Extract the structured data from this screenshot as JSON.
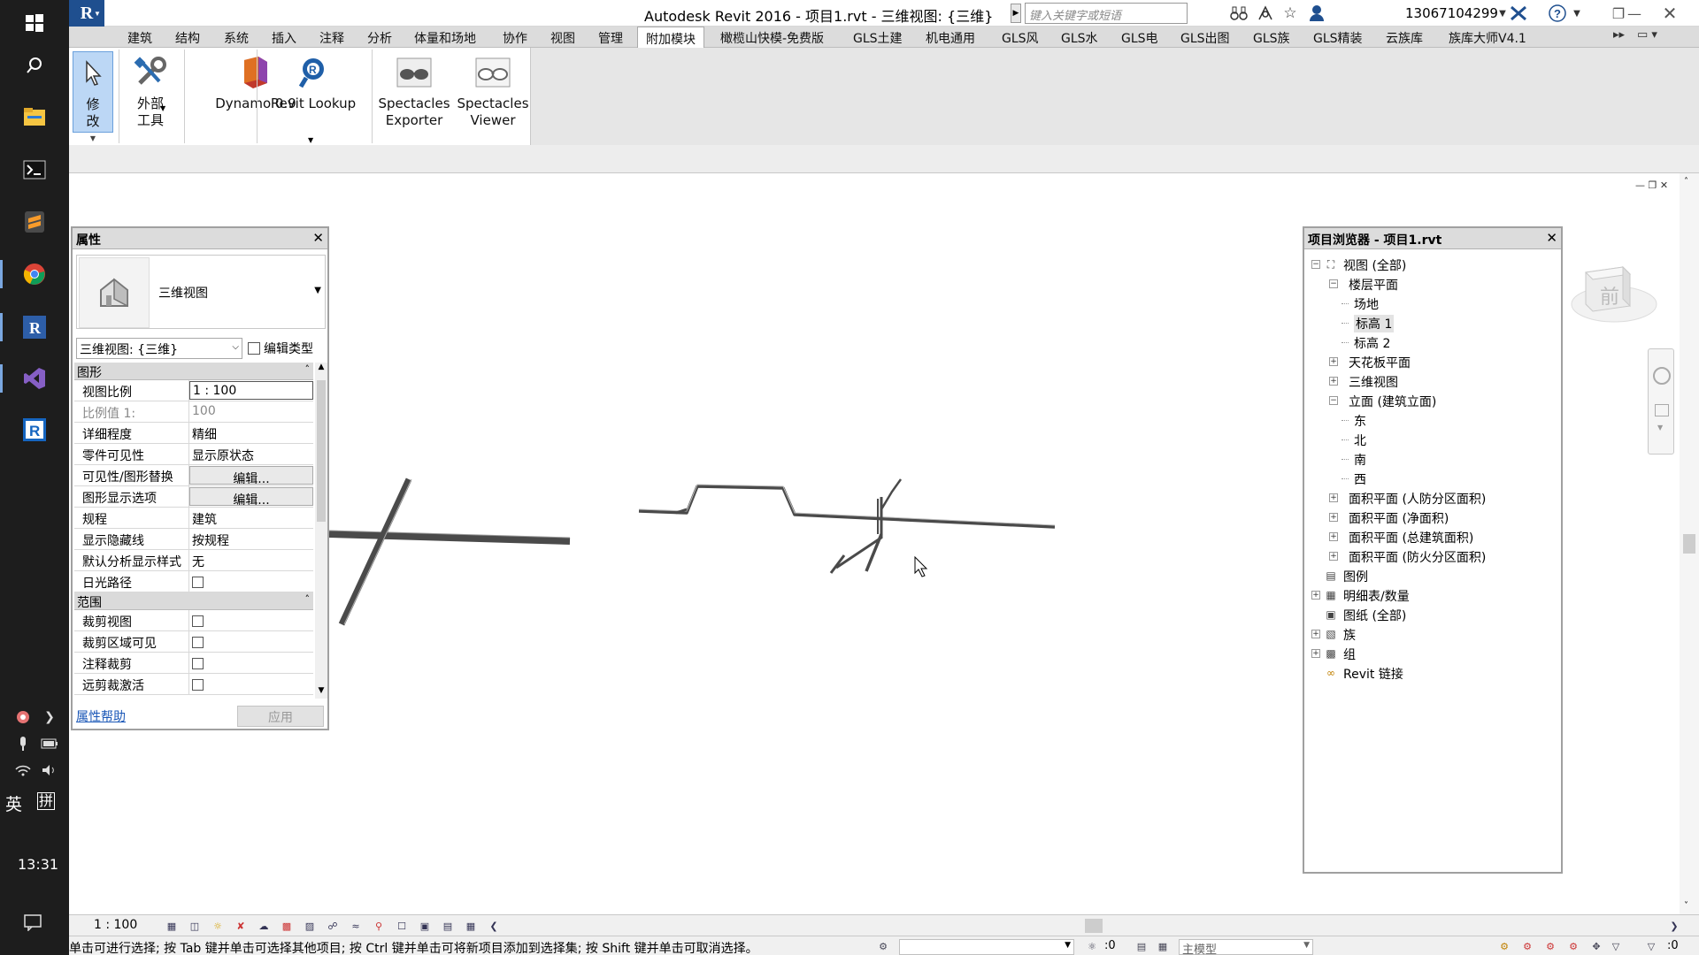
{
  "taskbar": {
    "time": "13:31",
    "ime_lang": "英",
    "ime_mode": "拼"
  },
  "window": {
    "title": "Autodesk Revit 2016 -    项目1.rvt - 三维视图: {三维}",
    "search_placeholder": "键入关键字或短语",
    "user": "13067104299"
  },
  "ribbon": {
    "tabs": [
      "建筑",
      "结构",
      "系统",
      "插入",
      "注释",
      "分析",
      "体量和场地",
      "协作",
      "视图",
      "管理",
      "附加模块",
      "橄榄山快模-免费版",
      "GLS土建",
      "机电通用",
      "GLS风",
      "GLS水",
      "GLS电",
      "GLS出图",
      "GLS族",
      "GLS精装",
      "云族库",
      "族库大师V4.1"
    ],
    "active_tab": "附加模块",
    "buttons": {
      "modify": "修改",
      "external_tools": "外部\n工具",
      "dynamo": "Dynamo 0.9",
      "revit_lookup": "Revit Lookup",
      "spectacles_exporter": "Spectacles\nExporter",
      "spectacles_viewer": "Spectacles\nViewer"
    }
  },
  "properties": {
    "title": "属性",
    "type_name": "三维视图",
    "instance_selector": "三维视图: {三维}",
    "edit_type": "编辑类型",
    "group_graphics": "图形",
    "group_extents": "范围",
    "rows_graphics": [
      {
        "name": "视图比例",
        "value": "1 : 100",
        "kind": "input"
      },
      {
        "name": "比例值 1:",
        "value": "100",
        "kind": "gray"
      },
      {
        "name": "详细程度",
        "value": "精细",
        "kind": "text"
      },
      {
        "name": "零件可见性",
        "value": "显示原状态",
        "kind": "text"
      },
      {
        "name": "可见性/图形替换",
        "value": "编辑...",
        "kind": "button"
      },
      {
        "name": "图形显示选项",
        "value": "编辑...",
        "kind": "button"
      },
      {
        "name": "规程",
        "value": "建筑",
        "kind": "text"
      },
      {
        "name": "显示隐藏线",
        "value": "按规程",
        "kind": "text"
      },
      {
        "name": "默认分析显示样式",
        "value": "无",
        "kind": "text"
      },
      {
        "name": "日光路径",
        "value": "",
        "kind": "checkbox"
      }
    ],
    "rows_extents": [
      {
        "name": "裁剪视图",
        "value": "",
        "kind": "checkbox"
      },
      {
        "name": "裁剪区域可见",
        "value": "",
        "kind": "checkbox"
      },
      {
        "name": "注释裁剪",
        "value": "",
        "kind": "checkbox"
      },
      {
        "name": "远剪裁激活",
        "value": "",
        "kind": "checkbox"
      }
    ],
    "help_link": "属性帮助",
    "apply": "应用"
  },
  "browser": {
    "title": "项目浏览器 - 项目1.rvt",
    "nodes": [
      {
        "label": "视图 (全部)",
        "level": 0,
        "exp": "-",
        "icon": "views"
      },
      {
        "label": "楼层平面",
        "level": 1,
        "exp": "-"
      },
      {
        "label": "场地",
        "level": 2
      },
      {
        "label": "标高 1",
        "level": 2,
        "selected": true
      },
      {
        "label": "标高 2",
        "level": 2
      },
      {
        "label": "天花板平面",
        "level": 1,
        "exp": "+"
      },
      {
        "label": "三维视图",
        "level": 1,
        "exp": "+"
      },
      {
        "label": "立面 (建筑立面)",
        "level": 1,
        "exp": "-"
      },
      {
        "label": "东",
        "level": 2
      },
      {
        "label": "北",
        "level": 2
      },
      {
        "label": "南",
        "level": 2
      },
      {
        "label": "西",
        "level": 2
      },
      {
        "label": "面积平面 (人防分区面积)",
        "level": 1,
        "exp": "+"
      },
      {
        "label": "面积平面 (净面积)",
        "level": 1,
        "exp": "+"
      },
      {
        "label": "面积平面 (总建筑面积)",
        "level": 1,
        "exp": "+"
      },
      {
        "label": "面积平面 (防火分区面积)",
        "level": 1,
        "exp": "+"
      },
      {
        "label": "图例",
        "level": 0,
        "icon": "legend"
      },
      {
        "label": "明细表/数量",
        "level": 0,
        "exp": "+",
        "icon": "schedule"
      },
      {
        "label": "图纸 (全部)",
        "level": 0,
        "icon": "sheet"
      },
      {
        "label": "族",
        "level": 0,
        "exp": "+",
        "icon": "family"
      },
      {
        "label": "组",
        "level": 0,
        "exp": "+",
        "icon": "group"
      },
      {
        "label": "Revit 链接",
        "level": 0,
        "icon": "link"
      }
    ]
  },
  "viewcube": {
    "face": "前"
  },
  "viewbar": {
    "scale": "1 : 100"
  },
  "status": {
    "message": "单击可进行选择; 按 Tab 键并单击可选择其他项目; 按 Ctrl 键并单击可将新项目添加到选择集; 按 Shift 键并单击可取消选择。",
    "count": ":0",
    "model": "主模型",
    "filter": ":0"
  }
}
